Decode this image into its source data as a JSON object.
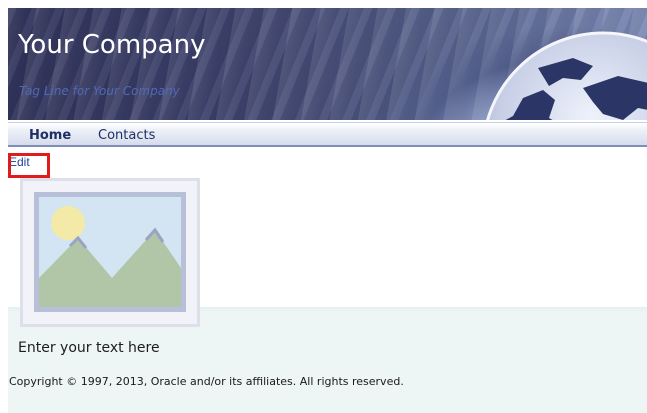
{
  "header": {
    "company_name": "Your Company",
    "tagline": "Tag Line for Your Company"
  },
  "nav": {
    "tabs": [
      {
        "label": "Home",
        "active": true
      },
      {
        "label": "Contacts",
        "active": false
      }
    ]
  },
  "toolbar": {
    "edit_label": "Edit"
  },
  "main": {
    "image_icon": "image-placeholder-icon",
    "body_text": "Enter your text here"
  },
  "footer": {
    "copyright": "Copyright © 1997, 2013, Oracle and/or its affiliates. All rights reserved."
  },
  "colors": {
    "highlight_box": "#e01b1b",
    "link": "#1c3f94",
    "nav_text": "#1f2f66"
  }
}
